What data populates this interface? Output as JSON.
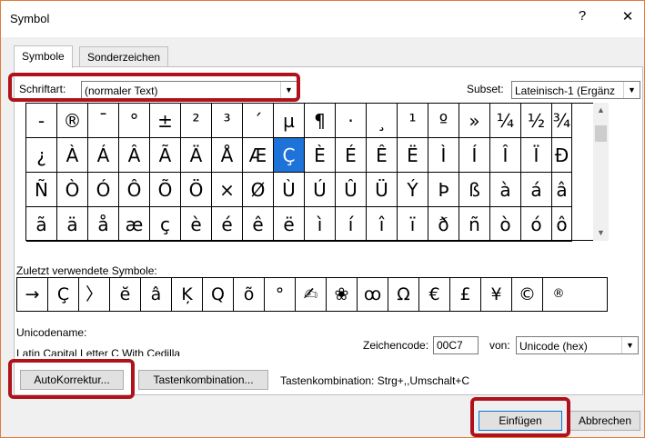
{
  "window": {
    "title": "Symbol",
    "help": "?",
    "close": "✕"
  },
  "tabs": [
    {
      "label": "Symbole"
    },
    {
      "label": "Sonderzeichen"
    }
  ],
  "font": {
    "label": "Schriftart:",
    "value": "(normaler Text)"
  },
  "subset": {
    "label": "Subset:",
    "value": "Lateinisch-1 (Ergänz"
  },
  "symbols": [
    "-",
    "®",
    "¯",
    "°",
    "±",
    "²",
    "³",
    "´",
    "µ",
    "¶",
    "·",
    "¸",
    "¹",
    "º",
    "»",
    "¼",
    "½",
    "¾",
    "¿",
    "À",
    "Á",
    "Â",
    "Ã",
    "Ä",
    "Å",
    "Æ",
    "Ç",
    "È",
    "É",
    "Ê",
    "Ë",
    "Ì",
    "Í",
    "Î",
    "Ï",
    "Ð",
    "Ñ",
    "Ò",
    "Ó",
    "Ô",
    "Õ",
    "Ö",
    "×",
    "Ø",
    "Ù",
    "Ú",
    "Û",
    "Ü",
    "Ý",
    "Þ",
    "ß",
    "à",
    "á",
    "â",
    "ã",
    "ä",
    "å",
    "æ",
    "ç",
    "è",
    "é",
    "ê",
    "ë",
    "ì",
    "í",
    "î",
    "ï",
    "ð",
    "ñ",
    "ò",
    "ó",
    "ô"
  ],
  "selected_symbol": "Ç",
  "recent": {
    "label": "Zuletzt verwendete Symbole:",
    "symbols": [
      "→",
      "Ç",
      "〉",
      "ĕ",
      "â",
      "Ķ",
      "Q",
      "õ",
      "°",
      "✍",
      "❀",
      "ꝏ",
      "Ω",
      "€",
      "£",
      "¥",
      "©",
      "®"
    ]
  },
  "unicode_name": {
    "label": "Unicodename:",
    "value": "Latin Capital Letter C With Cedilla"
  },
  "char_code": {
    "label": "Zeichencode:",
    "value": "00C7"
  },
  "from": {
    "label": "von:",
    "value": "Unicode (hex)"
  },
  "buttons": {
    "autocorrect": "AutoKorrektur...",
    "shortcut_key": "Tastenkombination...",
    "shortcut_text": "Tastenkombination: Strg+,,Umschalt+C",
    "insert": "Einfügen",
    "cancel": "Abbrechen"
  },
  "colors": {
    "highlight": "#b0121b",
    "selection": "#1e73d9",
    "window_border": "#e07b3a"
  }
}
